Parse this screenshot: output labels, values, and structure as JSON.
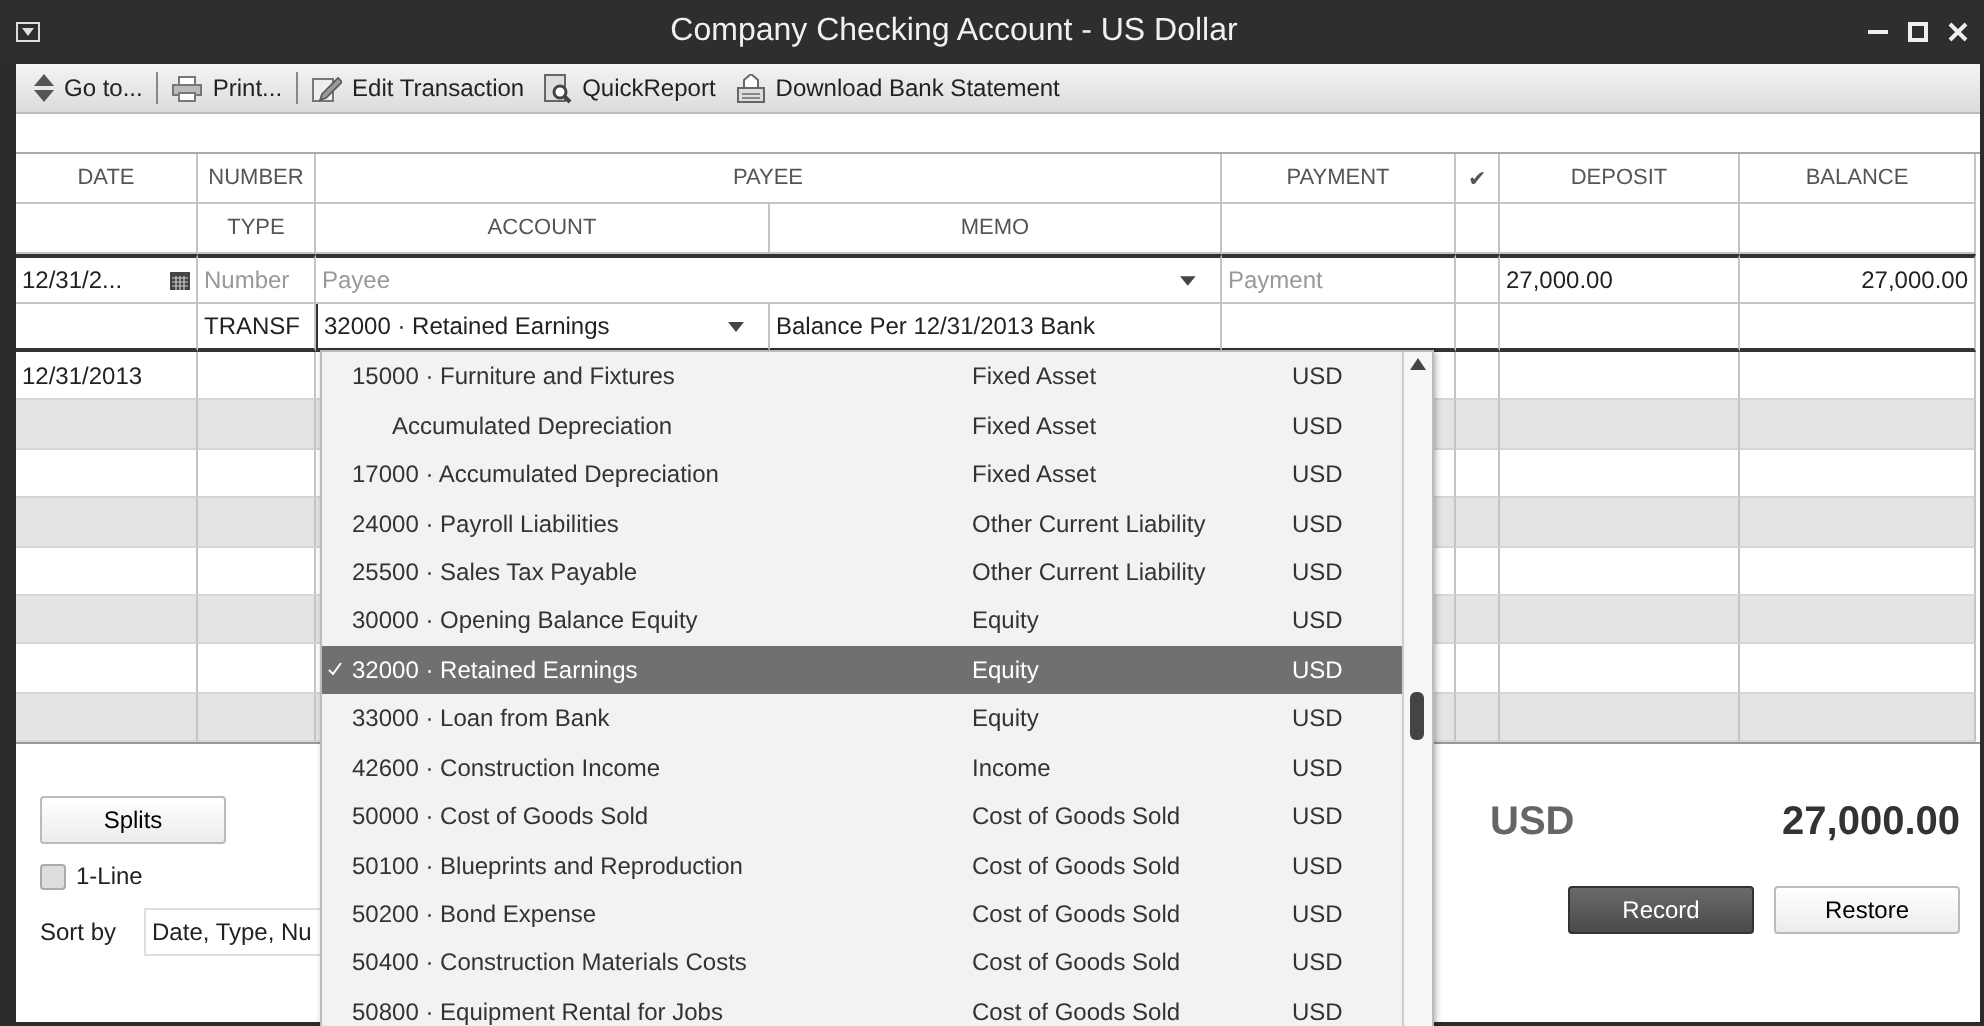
{
  "window": {
    "title": "Company Checking Account - US Dollar"
  },
  "toolbar_groups": [
    {
      "items": [
        {
          "label": "Go to...",
          "kind": "goto"
        }
      ]
    },
    {
      "items": [
        {
          "label": "Print...",
          "kind": "print"
        }
      ]
    },
    {
      "items": [
        {
          "label": "Edit Transaction",
          "kind": "edit"
        },
        {
          "label": "QuickReport",
          "kind": "report"
        },
        {
          "label": "Download Bank Statement",
          "kind": "download"
        }
      ]
    }
  ],
  "register": {
    "header_top": [
      "DATE",
      "NUMBER",
      "PAYEE",
      "PAYMENT",
      "✔",
      "DEPOSIT",
      "BALANCE"
    ],
    "header_bottom": [
      "TYPE",
      "ACCOUNT",
      "MEMO"
    ],
    "entry": {
      "date": "12/31/2...",
      "number_placeholder": "Number",
      "payee_placeholder": "Payee",
      "payment_placeholder": "Payment",
      "deposit": "27,000.00",
      "balance": "27,000.00",
      "type": "TRANSF",
      "account": "32000 · Retained Earnings",
      "memo": "Balance Per 12/31/2013 Bank"
    },
    "rows": [
      {
        "date": "12/31/2013"
      }
    ]
  },
  "dropdown": {
    "items": [
      {
        "name": "15000 · Furniture and Fixtures",
        "type": "Fixed Asset",
        "currency": "USD",
        "selected": false,
        "children": [
          {
            "name": "Accumulated Depreciation",
            "type": "Fixed Asset",
            "currency": "USD",
            "selected": false
          }
        ]
      },
      {
        "name": "17000 · Accumulated Depreciation",
        "type": "Fixed Asset",
        "currency": "USD",
        "selected": false
      },
      {
        "name": "24000 · Payroll Liabilities",
        "type": "Other Current Liability",
        "currency": "USD",
        "selected": false
      },
      {
        "name": "25500 · Sales Tax Payable",
        "type": "Other Current Liability",
        "currency": "USD",
        "selected": false
      },
      {
        "name": "30000 · Opening Balance Equity",
        "type": "Equity",
        "currency": "USD",
        "selected": false
      },
      {
        "name": "32000 · Retained Earnings",
        "type": "Equity",
        "currency": "USD",
        "selected": true
      },
      {
        "name": "33000 · Loan from Bank",
        "type": "Equity",
        "currency": "USD",
        "selected": false
      },
      {
        "name": "42600 · Construction Income",
        "type": "Income",
        "currency": "USD",
        "selected": false
      },
      {
        "name": "50000 · Cost of Goods Sold",
        "type": "Cost of Goods Sold",
        "currency": "USD",
        "selected": false
      },
      {
        "name": "50100 · Blueprints and Reproduction",
        "type": "Cost of Goods Sold",
        "currency": "USD",
        "selected": false
      },
      {
        "name": "50200 · Bond Expense",
        "type": "Cost of Goods Sold",
        "currency": "USD",
        "selected": false
      },
      {
        "name": "50400 · Construction Materials Costs",
        "type": "Cost of Goods Sold",
        "currency": "USD",
        "selected": false
      },
      {
        "name": "50800 · Equipment Rental for Jobs",
        "type": "Cost of Goods Sold",
        "currency": "USD",
        "selected": false
      }
    ]
  },
  "footer": {
    "splits": "Splits",
    "one_line": {
      "label": "1-Line",
      "checked": false
    },
    "sort_label": "Sort by",
    "sort_value": "Date, Type, Nu",
    "currency": "USD",
    "total": "27,000.00",
    "record": "Record",
    "restore": "Restore"
  }
}
